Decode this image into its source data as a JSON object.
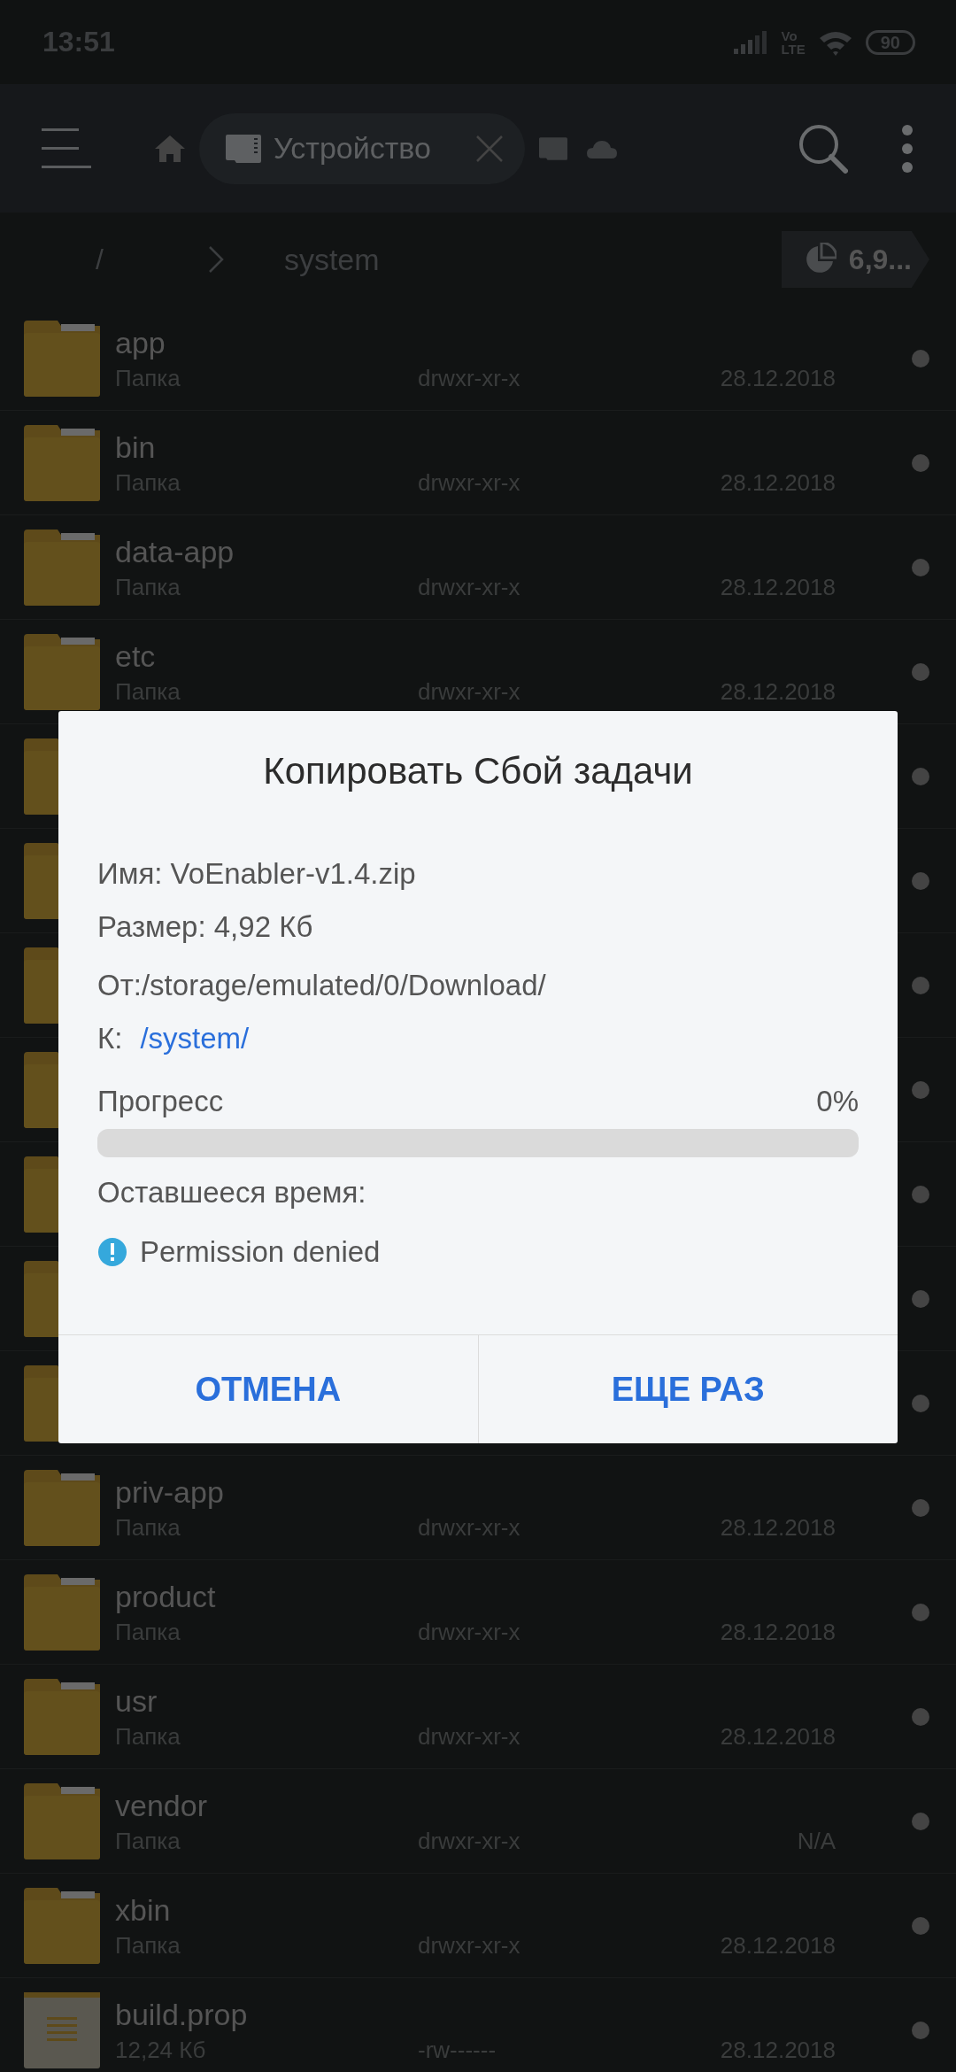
{
  "status_bar": {
    "time": "13:51",
    "volte_top": "Vo",
    "volte_bottom": "LTE",
    "battery": "90"
  },
  "toolbar": {
    "tab_label": "Устройство"
  },
  "breadcrumb": {
    "root": "/",
    "current": "system",
    "storage": "6,9..."
  },
  "rows": [
    {
      "kind": "folder",
      "name": "app",
      "type": "Папка",
      "perms": "drwxr-xr-x",
      "date": "28.12.2018"
    },
    {
      "kind": "folder",
      "name": "bin",
      "type": "Папка",
      "perms": "drwxr-xr-x",
      "date": "28.12.2018"
    },
    {
      "kind": "folder",
      "name": "data-app",
      "type": "Папка",
      "perms": "drwxr-xr-x",
      "date": "28.12.2018"
    },
    {
      "kind": "folder",
      "name": "etc",
      "type": "Папка",
      "perms": "drwxr-xr-x",
      "date": "28.12.2018"
    },
    {
      "kind": "folder"
    },
    {
      "kind": "folder"
    },
    {
      "kind": "folder"
    },
    {
      "kind": "folder"
    },
    {
      "kind": "folder"
    },
    {
      "kind": "folder"
    },
    {
      "kind": "folder"
    },
    {
      "kind": "folder",
      "name": "priv-app",
      "type": "Папка",
      "perms": "drwxr-xr-x",
      "date": "28.12.2018"
    },
    {
      "kind": "folder",
      "name": "product",
      "type": "Папка",
      "perms": "drwxr-xr-x",
      "date": "28.12.2018"
    },
    {
      "kind": "folder",
      "name": "usr",
      "type": "Папка",
      "perms": "drwxr-xr-x",
      "date": "28.12.2018"
    },
    {
      "kind": "folder",
      "name": "vendor",
      "type": "Папка",
      "perms": "drwxr-xr-x",
      "date": "N/A"
    },
    {
      "kind": "folder",
      "name": "xbin",
      "type": "Папка",
      "perms": "drwxr-xr-x",
      "date": "28.12.2018"
    },
    {
      "kind": "text-file",
      "name": "build.prop",
      "type": "12,24 Кб",
      "perms": "-rw------",
      "date": "28.12.2018"
    }
  ],
  "dialog": {
    "title": "Копировать Сбой задачи",
    "name": "Имя: VoEnabler-v1.4.zip",
    "size": "Размер: 4,92 Кб",
    "from": "От:/storage/emulated/0/Download/",
    "to_label": "К:",
    "to_link": "/system/",
    "progress_label": "Прогресс",
    "progress_value": "0%",
    "level": 0,
    "remaining": "Оставшееся время:",
    "error": "Permission denied",
    "buttons": [
      "ОТМЕНА",
      "ЕЩЕ РАЗ"
    ]
  }
}
